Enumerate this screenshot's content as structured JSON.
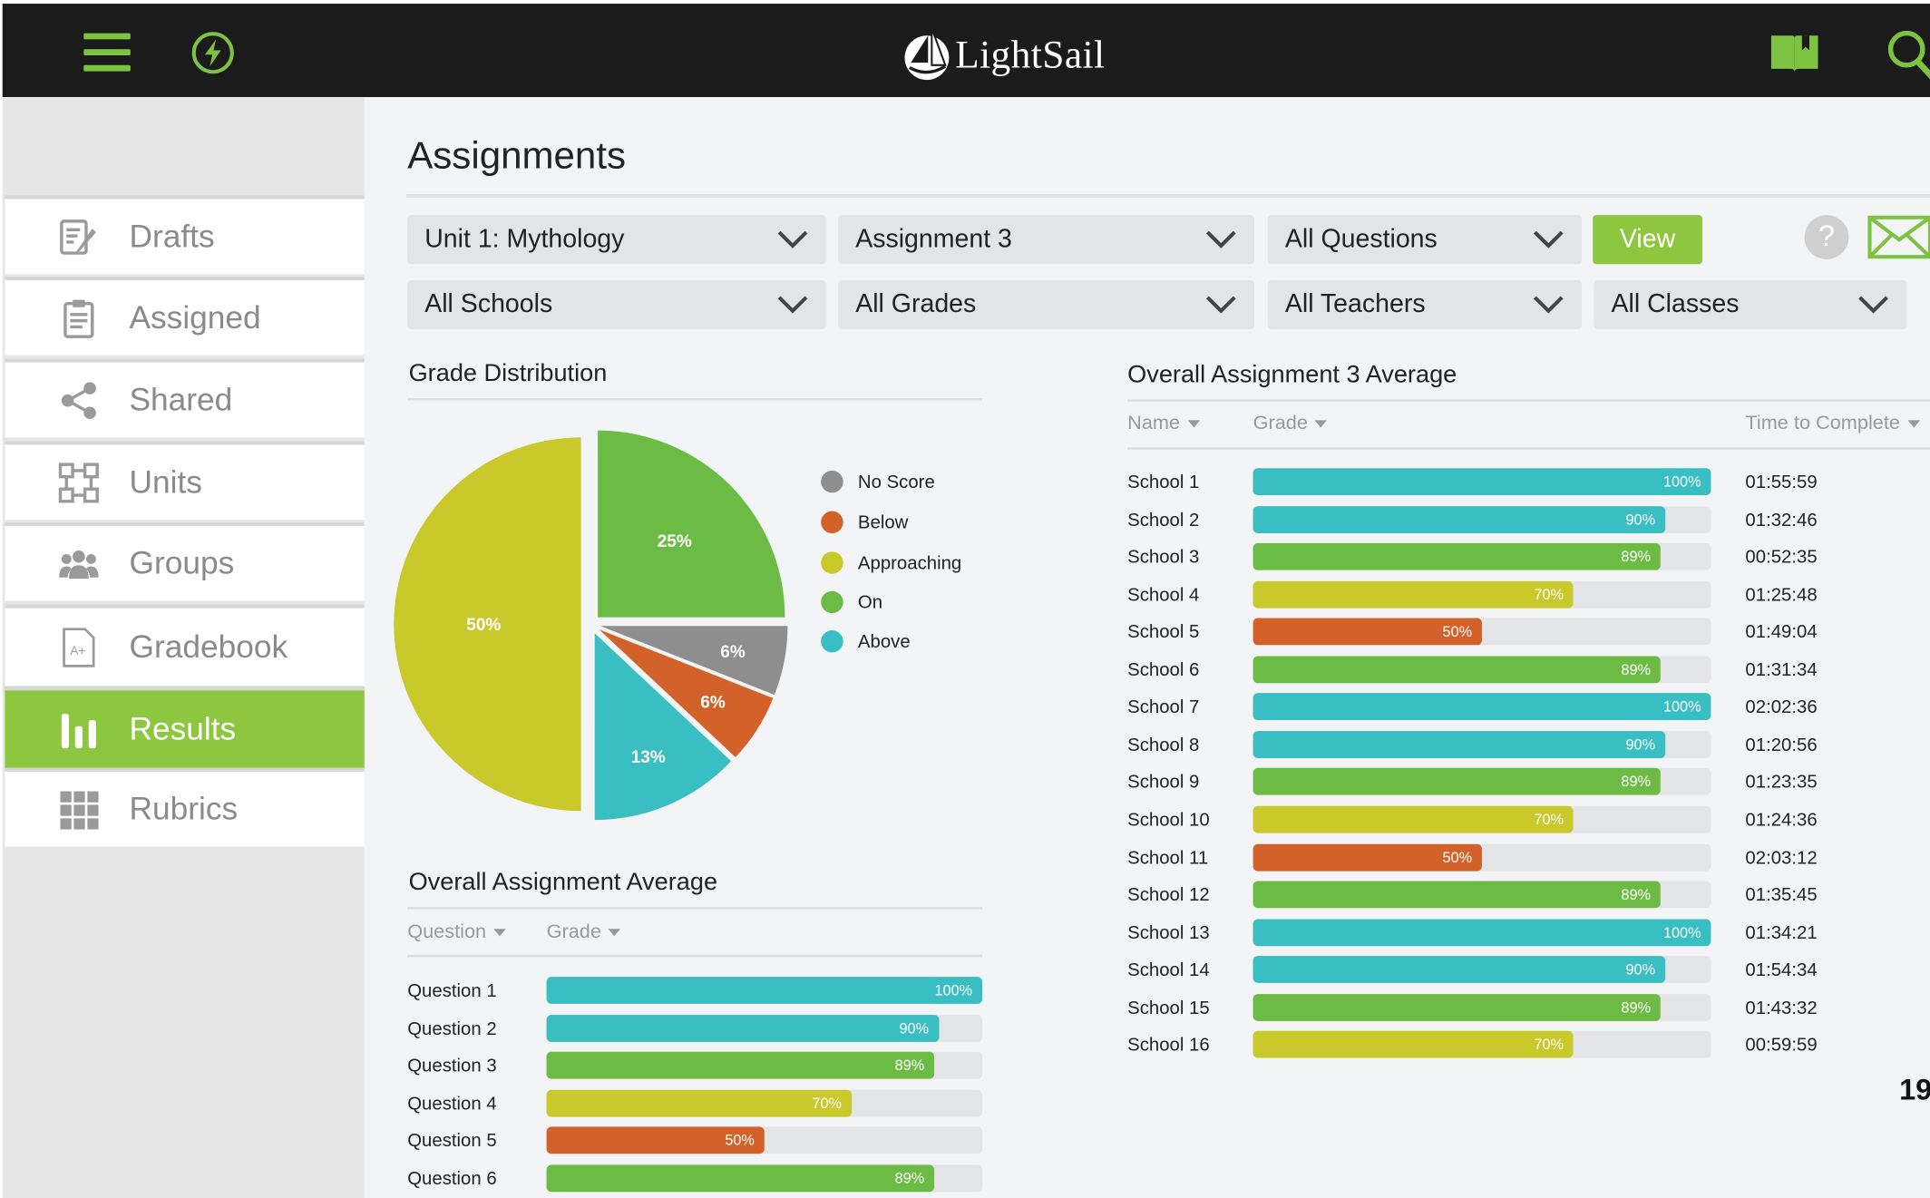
{
  "app": {
    "name": "LightSail"
  },
  "colors": {
    "brand_green": "#8dc63f",
    "no_score": "#8e8e8e",
    "below": "#d2622a",
    "approaching": "#c9c92c",
    "on": "#6cbb45",
    "above": "#38bec3"
  },
  "header": {
    "menu_icon": "hamburger-menu-icon",
    "bolt_icon": "lightning-bolt-icon",
    "book_icon": "open-book-icon",
    "search_icon": "search-icon"
  },
  "sidebar": {
    "items": [
      {
        "label": "Drafts",
        "icon": "pencil-document-icon",
        "active": false
      },
      {
        "label": "Assigned",
        "icon": "clipboard-icon",
        "active": false
      },
      {
        "label": "Shared",
        "icon": "share-icon",
        "active": false
      },
      {
        "label": "Units",
        "icon": "units-icon",
        "active": false
      },
      {
        "label": "Groups",
        "icon": "people-icon",
        "active": false
      },
      {
        "label": "Gradebook",
        "icon": "gradebook-icon",
        "active": false
      },
      {
        "label": "Results",
        "icon": "bar-chart-icon",
        "active": true
      },
      {
        "label": "Rubrics",
        "icon": "grid-icon",
        "active": false
      }
    ]
  },
  "page": {
    "title": "Assignments"
  },
  "filters": {
    "unit": "Unit 1: Mythology",
    "assignment": "Assignment 3",
    "questions": "All Questions",
    "schools": "All Schools",
    "grades": "All Grades",
    "teachers": "All Teachers",
    "classes": "All Classes",
    "view_label": "View",
    "help_label": "?"
  },
  "grade_distribution": {
    "title": "Grade Distribution",
    "legend": [
      "No Score",
      "Below",
      "Approaching",
      "On",
      "Above"
    ]
  },
  "overall_average": {
    "title": "Overall Assignment Average",
    "col_question": "Question",
    "col_grade": "Grade",
    "rows": [
      {
        "name": "Question 1",
        "pct_label": "100%"
      },
      {
        "name": "Question 2",
        "pct_label": "90%"
      },
      {
        "name": "Question 3",
        "pct_label": "89%"
      },
      {
        "name": "Question 4",
        "pct_label": "70%"
      },
      {
        "name": "Question 5",
        "pct_label": "50%"
      },
      {
        "name": "Question 6",
        "pct_label": "89%"
      }
    ]
  },
  "assignment_average": {
    "title": "Overall Assignment 3 Average",
    "col_name": "Name",
    "col_grade": "Grade",
    "col_time": "Time to Complete",
    "rows": [
      {
        "name": "School 1",
        "pct_label": "100%",
        "time": "01:55:59"
      },
      {
        "name": "School 2",
        "pct_label": "90%",
        "time": "01:32:46"
      },
      {
        "name": "School 3",
        "pct_label": "89%",
        "time": "00:52:35"
      },
      {
        "name": "School 4",
        "pct_label": "70%",
        "time": "01:25:48"
      },
      {
        "name": "School 5",
        "pct_label": "50%",
        "time": "01:49:04"
      },
      {
        "name": "School 6",
        "pct_label": "89%",
        "time": "01:31:34"
      },
      {
        "name": "School 7",
        "pct_label": "100%",
        "time": "02:02:36"
      },
      {
        "name": "School 8",
        "pct_label": "90%",
        "time": "01:20:56"
      },
      {
        "name": "School 9",
        "pct_label": "89%",
        "time": "01:23:35"
      },
      {
        "name": "School 10",
        "pct_label": "70%",
        "time": "01:24:36"
      },
      {
        "name": "School 11",
        "pct_label": "50%",
        "time": "02:03:12"
      },
      {
        "name": "School 12",
        "pct_label": "89%",
        "time": "01:35:45"
      },
      {
        "name": "School 13",
        "pct_label": "100%",
        "time": "01:34:21"
      },
      {
        "name": "School 14",
        "pct_label": "90%",
        "time": "01:54:34"
      },
      {
        "name": "School 15",
        "pct_label": "89%",
        "time": "01:43:32"
      },
      {
        "name": "School 16",
        "pct_label": "70%",
        "time": "00:59:59"
      }
    ]
  },
  "page_number_partial": "19",
  "chart_data": [
    {
      "type": "pie",
      "title": "Grade Distribution",
      "categories": [
        "On",
        "No Score",
        "Below",
        "Above",
        "Approaching"
      ],
      "values": [
        25,
        6,
        6,
        13,
        50
      ],
      "labels": [
        "25%",
        "6%",
        "6%",
        "13%",
        "50%"
      ],
      "colors": [
        "#6cbb45",
        "#8e8e8e",
        "#d2622a",
        "#38bec3",
        "#c9c92c"
      ],
      "legend": [
        "No Score",
        "Below",
        "Approaching",
        "On",
        "Above"
      ]
    },
    {
      "type": "bar",
      "title": "Overall Assignment Average",
      "orientation": "horizontal",
      "categories": [
        "Question 1",
        "Question 2",
        "Question 3",
        "Question 4",
        "Question 5",
        "Question 6"
      ],
      "values": [
        100,
        90,
        89,
        70,
        50,
        89
      ],
      "colors": [
        "#38bec3",
        "#38bec3",
        "#6cbb45",
        "#c9c92c",
        "#d2622a",
        "#6cbb45"
      ],
      "xlim": [
        0,
        100
      ]
    },
    {
      "type": "bar",
      "title": "Overall Assignment 3 Average",
      "orientation": "horizontal",
      "categories": [
        "School 1",
        "School 2",
        "School 3",
        "School 4",
        "School 5",
        "School 6",
        "School 7",
        "School 8",
        "School 9",
        "School 10",
        "School 11",
        "School 12",
        "School 13",
        "School 14",
        "School 15",
        "School 16"
      ],
      "values": [
        100,
        90,
        89,
        70,
        50,
        89,
        100,
        90,
        89,
        70,
        50,
        89,
        100,
        90,
        89,
        70
      ],
      "colors": [
        "#38bec3",
        "#38bec3",
        "#6cbb45",
        "#c9c92c",
        "#d2622a",
        "#6cbb45",
        "#38bec3",
        "#38bec3",
        "#6cbb45",
        "#c9c92c",
        "#d2622a",
        "#6cbb45",
        "#38bec3",
        "#38bec3",
        "#6cbb45",
        "#c9c92c"
      ],
      "xlim": [
        0,
        100
      ]
    }
  ]
}
